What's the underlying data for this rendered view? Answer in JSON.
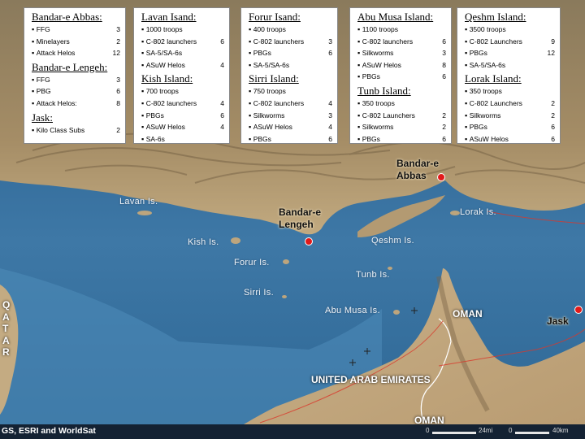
{
  "boxes": [
    {
      "sections": [
        {
          "title": "Bandar-e Abbas:",
          "items": [
            {
              "name": "FFG",
              "count": "3"
            },
            {
              "name": "Minelayers",
              "count": "2"
            },
            {
              "name": "Attack Helos",
              "count": "12"
            }
          ]
        },
        {
          "title": "Bandar-e Lengeh:",
          "items": [
            {
              "name": "FFG",
              "count": "3"
            },
            {
              "name": "PBG",
              "count": "6"
            },
            {
              "name": "Attack Helos:",
              "count": "8"
            }
          ]
        },
        {
          "title": "Jask:",
          "items": [
            {
              "name": "Kilo Class Subs",
              "count": "2"
            }
          ]
        }
      ]
    },
    {
      "sections": [
        {
          "title": "Lavan Isand:",
          "items": [
            {
              "name": "1000 troops",
              "count": ""
            },
            {
              "name": "C-802 launchers",
              "count": "6"
            },
            {
              "name": "SA-5/SA-6s",
              "count": ""
            },
            {
              "name": "ASuW Helos",
              "count": "4"
            }
          ]
        },
        {
          "title": "Kish Island:",
          "items": [
            {
              "name": "700 troops",
              "count": ""
            },
            {
              "name": "C-802 launchers",
              "count": "4"
            },
            {
              "name": "PBGs",
              "count": "6"
            },
            {
              "name": "ASuW Helos",
              "count": "4"
            },
            {
              "name": "SA-6s",
              "count": ""
            }
          ]
        }
      ]
    },
    {
      "sections": [
        {
          "title": "Forur Isand:",
          "items": [
            {
              "name": "400 troops",
              "count": ""
            },
            {
              "name": "C-802 launchers",
              "count": "3"
            },
            {
              "name": "PBGs",
              "count": "6"
            },
            {
              "name": "SA-5/SA-6s",
              "count": ""
            }
          ]
        },
        {
          "title": "Sirri Island:",
          "items": [
            {
              "name": "750 troops",
              "count": ""
            },
            {
              "name": "C-802 launchers",
              "count": "4"
            },
            {
              "name": "Silkworms",
              "count": "3"
            },
            {
              "name": "ASuW Helos",
              "count": "4"
            },
            {
              "name": "PBGs",
              "count": "6"
            }
          ]
        }
      ]
    },
    {
      "sections": [
        {
          "title": "Abu Musa Island:",
          "items": [
            {
              "name": "1100 troops",
              "count": ""
            },
            {
              "name": "C-802 launchers",
              "count": "6"
            },
            {
              "name": "Silkworms",
              "count": "3"
            },
            {
              "name": "ASuW Helos",
              "count": "8"
            },
            {
              "name": "PBGs",
              "count": "6"
            }
          ]
        },
        {
          "title": "Tunb Island:",
          "items": [
            {
              "name": "350 troops",
              "count": ""
            },
            {
              "name": "C-802 Launchers",
              "count": "2"
            },
            {
              "name": "Silkworms",
              "count": "2"
            },
            {
              "name": "PBGs",
              "count": "6"
            }
          ]
        }
      ]
    },
    {
      "sections": [
        {
          "title": "Qeshm Island:",
          "items": [
            {
              "name": "3500 troops",
              "count": ""
            },
            {
              "name": "C-802 Launchers",
              "count": "9"
            },
            {
              "name": "PBGs",
              "count": "12"
            },
            {
              "name": "SA-5/SA-6s",
              "count": ""
            }
          ]
        },
        {
          "title": "Lorak Island:",
          "items": [
            {
              "name": "350 troops",
              "count": ""
            },
            {
              "name": "C-802 Launchers",
              "count": "2"
            },
            {
              "name": "Silkworms",
              "count": "2"
            },
            {
              "name": "PBGs",
              "count": "6"
            },
            {
              "name": "ASuW Helos",
              "count": "6"
            }
          ]
        }
      ]
    }
  ],
  "island_labels": {
    "lavan": "Lavan Is.",
    "kish": "Kish Is.",
    "forur": "Forur Is.",
    "sirri": "Sirri Is.",
    "abu_musa": "Abu Musa Is.",
    "tunb": "Tunb Is.",
    "qeshm": "Qeshm Is.",
    "lorak": "Lorak Is."
  },
  "cities": {
    "bandar_abbas": "Bandar-e\nAbbas",
    "bandar_lengeh": "Bandar-e\nLengeh",
    "jask": "Jask"
  },
  "countries": {
    "oman_north": "OMAN",
    "uae": "UNITED ARAB EMIRATES",
    "oman_south": "OMAN",
    "qatar": [
      "Q",
      "A",
      "T",
      "A",
      "R"
    ]
  },
  "footer": {
    "credit": "GS, ESRI and WorldSat",
    "scale1_zero": "0",
    "scale1_label": "24mi",
    "scale2_zero": "0",
    "scale2_label": "40km"
  },
  "colors": {
    "sea_dark": "#1d4a7a",
    "sea_light": "#5a8fb8",
    "land": "#b49a72",
    "marker": "#e21a1a"
  }
}
